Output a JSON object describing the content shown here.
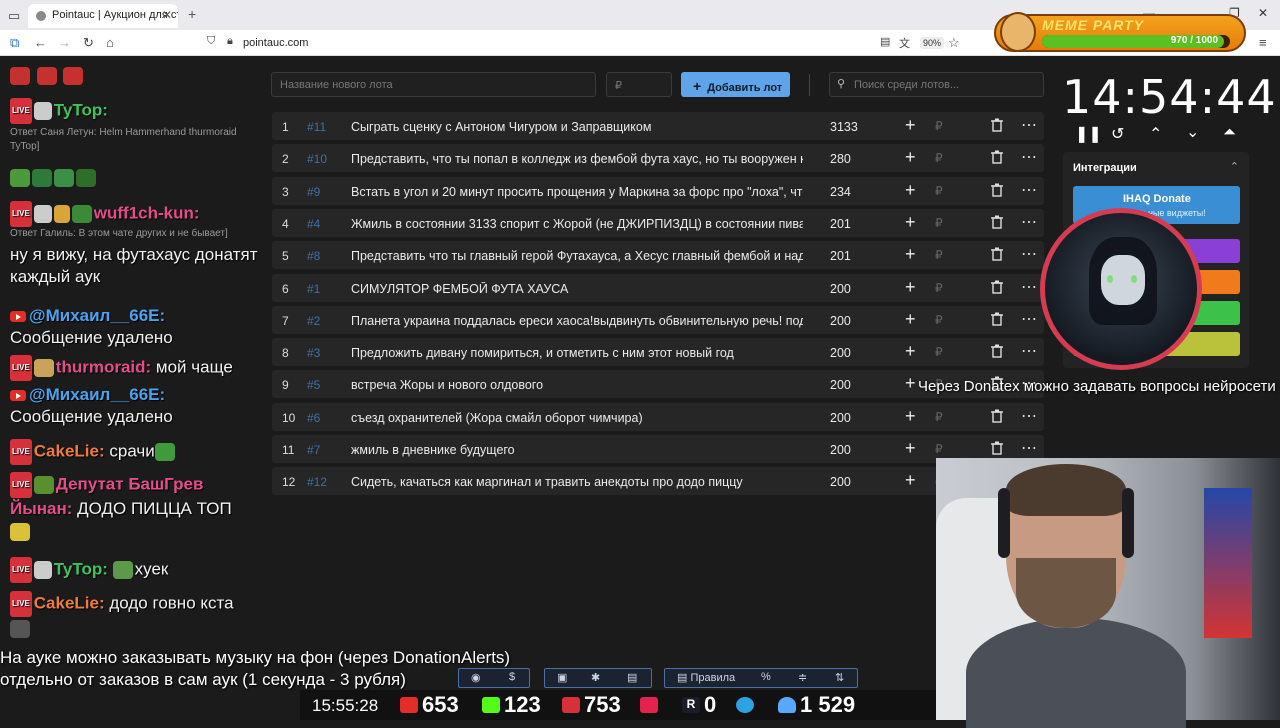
{
  "browser": {
    "tab_title": "Pointauc | Аукцион для стримера",
    "url": "pointauc.com",
    "zoom": "90%"
  },
  "meme_party": {
    "title": "MEME PARTY",
    "counter": "970 / 1000",
    "progress": 0.97
  },
  "chat": {
    "messages": [
      {
        "user": "TyTop:",
        "text": ""
      },
      {
        "reply": "Ответ Саня Летун: Helm Hammerhand thurmoraid TyTop]"
      },
      {
        "user": "wuff1ch-kun:",
        "text": ""
      },
      {
        "reply": "Ответ Галиль: В этом чате других и не бывает]"
      },
      {
        "text": "ну я вижу, на футахаус донатят каждый аук"
      },
      {
        "user": "@Михаил__66E:",
        "text": "Сообщение удалено"
      },
      {
        "user": "thurmoraid:",
        "text": "мой чаще"
      },
      {
        "user": "@Михаил__66E:",
        "text": "Сообщение удалено"
      },
      {
        "user": "CakeLie:",
        "text": "срачи"
      },
      {
        "user": "Депутат БашГрев Йынан:",
        "text": "ДОДО ПИЦЦА ТОП"
      },
      {
        "user": "TyTop:",
        "text": "хуек"
      },
      {
        "user": "CakeLie:",
        "text": "додо говно кста"
      }
    ]
  },
  "auction": {
    "new_lot_placeholder": "Название нового лота",
    "amount_placeholder": "₽",
    "add_button": "Добавить лот",
    "search_placeholder": "Поиск среди лотов...",
    "lots": [
      {
        "n": "1",
        "id": "#11",
        "name": "Сыграть сценку с Антоном Чигуром и Заправщиком",
        "amount": "3133"
      },
      {
        "n": "2",
        "id": "#10",
        "name": "Представить, что ты попал в колледж из фембой фута хаус, но ты вооружен кр",
        "amount": "280"
      },
      {
        "n": "3",
        "id": "#9",
        "name": "Встать в угол и 20 минут просить прощения у Маркина за форс про \"лоха\", что",
        "amount": "234"
      },
      {
        "n": "4",
        "id": "#4",
        "name": "Жмиль в состоянии 3133 спорит с Жорой (не ДЖИРПИЗДЦ) в состоянии пива",
        "amount": "201"
      },
      {
        "n": "5",
        "id": "#8",
        "name": "Представить что ты главный герой Футахауса, а Хесус главный фембой и надс",
        "amount": "201"
      },
      {
        "n": "6",
        "id": "#1",
        "name": "СИМУЛЯТОР ФЕМБОЙ ФУТА ХАУСА",
        "amount": "200"
      },
      {
        "n": "7",
        "id": "#2",
        "name": "Планета украина поддалась ереси хаоса!выдвинуть обвинительную речь! под",
        "amount": "200"
      },
      {
        "n": "8",
        "id": "#3",
        "name": "Предложить дивану помириться, и отметить с ним этот новый год",
        "amount": "200"
      },
      {
        "n": "9",
        "id": "#5",
        "name": "встреча Жоры и нового олдового",
        "amount": "200"
      },
      {
        "n": "10",
        "id": "#6",
        "name": "съезд охранителей (Жора смайл оборот чимчира)",
        "amount": "200"
      },
      {
        "n": "11",
        "id": "#7",
        "name": "жмиль в дневнике будущего",
        "amount": "200"
      },
      {
        "n": "12",
        "id": "#12",
        "name": "Сидеть, качаться как маргинал и травить анекдоты про додо пиццу",
        "amount": "200"
      }
    ]
  },
  "timer": "14:54:44",
  "integrations": {
    "title": "Интеграции",
    "donate_title": "IHAQ Donate",
    "donate_sub": "альные виджеты!"
  },
  "overlay_question": "Через Donatex можно задавать вопросы нейросети",
  "music_notice": {
    "line1": "На ауке можно заказывать музыку на фон (через DonationAlerts)",
    "line2": "отдельно от заказов в сам аук (1 секунда - 3 рубля)"
  },
  "toolbar": {
    "rules": "Правила",
    "percent": "%"
  },
  "stats": {
    "clock": "15:55:28",
    "youtube": "653",
    "kick": "123",
    "vk": "753",
    "rutube": "0",
    "viewers": "1 529"
  }
}
